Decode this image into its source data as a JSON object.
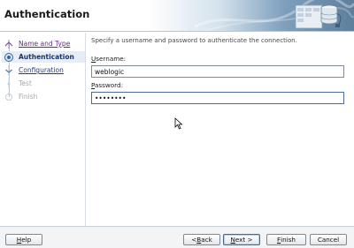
{
  "header": {
    "title": "Authentication",
    "icon": "database-connection-icon"
  },
  "steps": [
    {
      "label": "Name and Type",
      "state": "visited"
    },
    {
      "label": "Authentication",
      "state": "current"
    },
    {
      "label": "Configuration",
      "state": "link"
    },
    {
      "label": "Test",
      "state": "disabled"
    },
    {
      "label": "Finish",
      "state": "disabled"
    }
  ],
  "main": {
    "instruction": "Specify a username and password to authenticate the connection.",
    "username": {
      "mnemonic": "U",
      "rest": "sername:",
      "value": "weblogic"
    },
    "password": {
      "mnemonic": "P",
      "rest": "assword:",
      "value": "weblogic"
    }
  },
  "buttons": {
    "help": {
      "mnemonic": "H",
      "rest": "elp"
    },
    "back": {
      "prefix": "< ",
      "mnemonic": "B",
      "rest": "ack"
    },
    "next": {
      "mnemonic": "N",
      "rest": "ext >"
    },
    "finish": {
      "mnemonic": "F",
      "rest": "inish"
    },
    "cancel": {
      "label": "Cancel"
    }
  },
  "colors": {
    "visited_link": "#6a2b83",
    "link": "#1f3c86",
    "current_bg": "#e6edf5",
    "header_gradient_end": "#5d7f9d"
  }
}
